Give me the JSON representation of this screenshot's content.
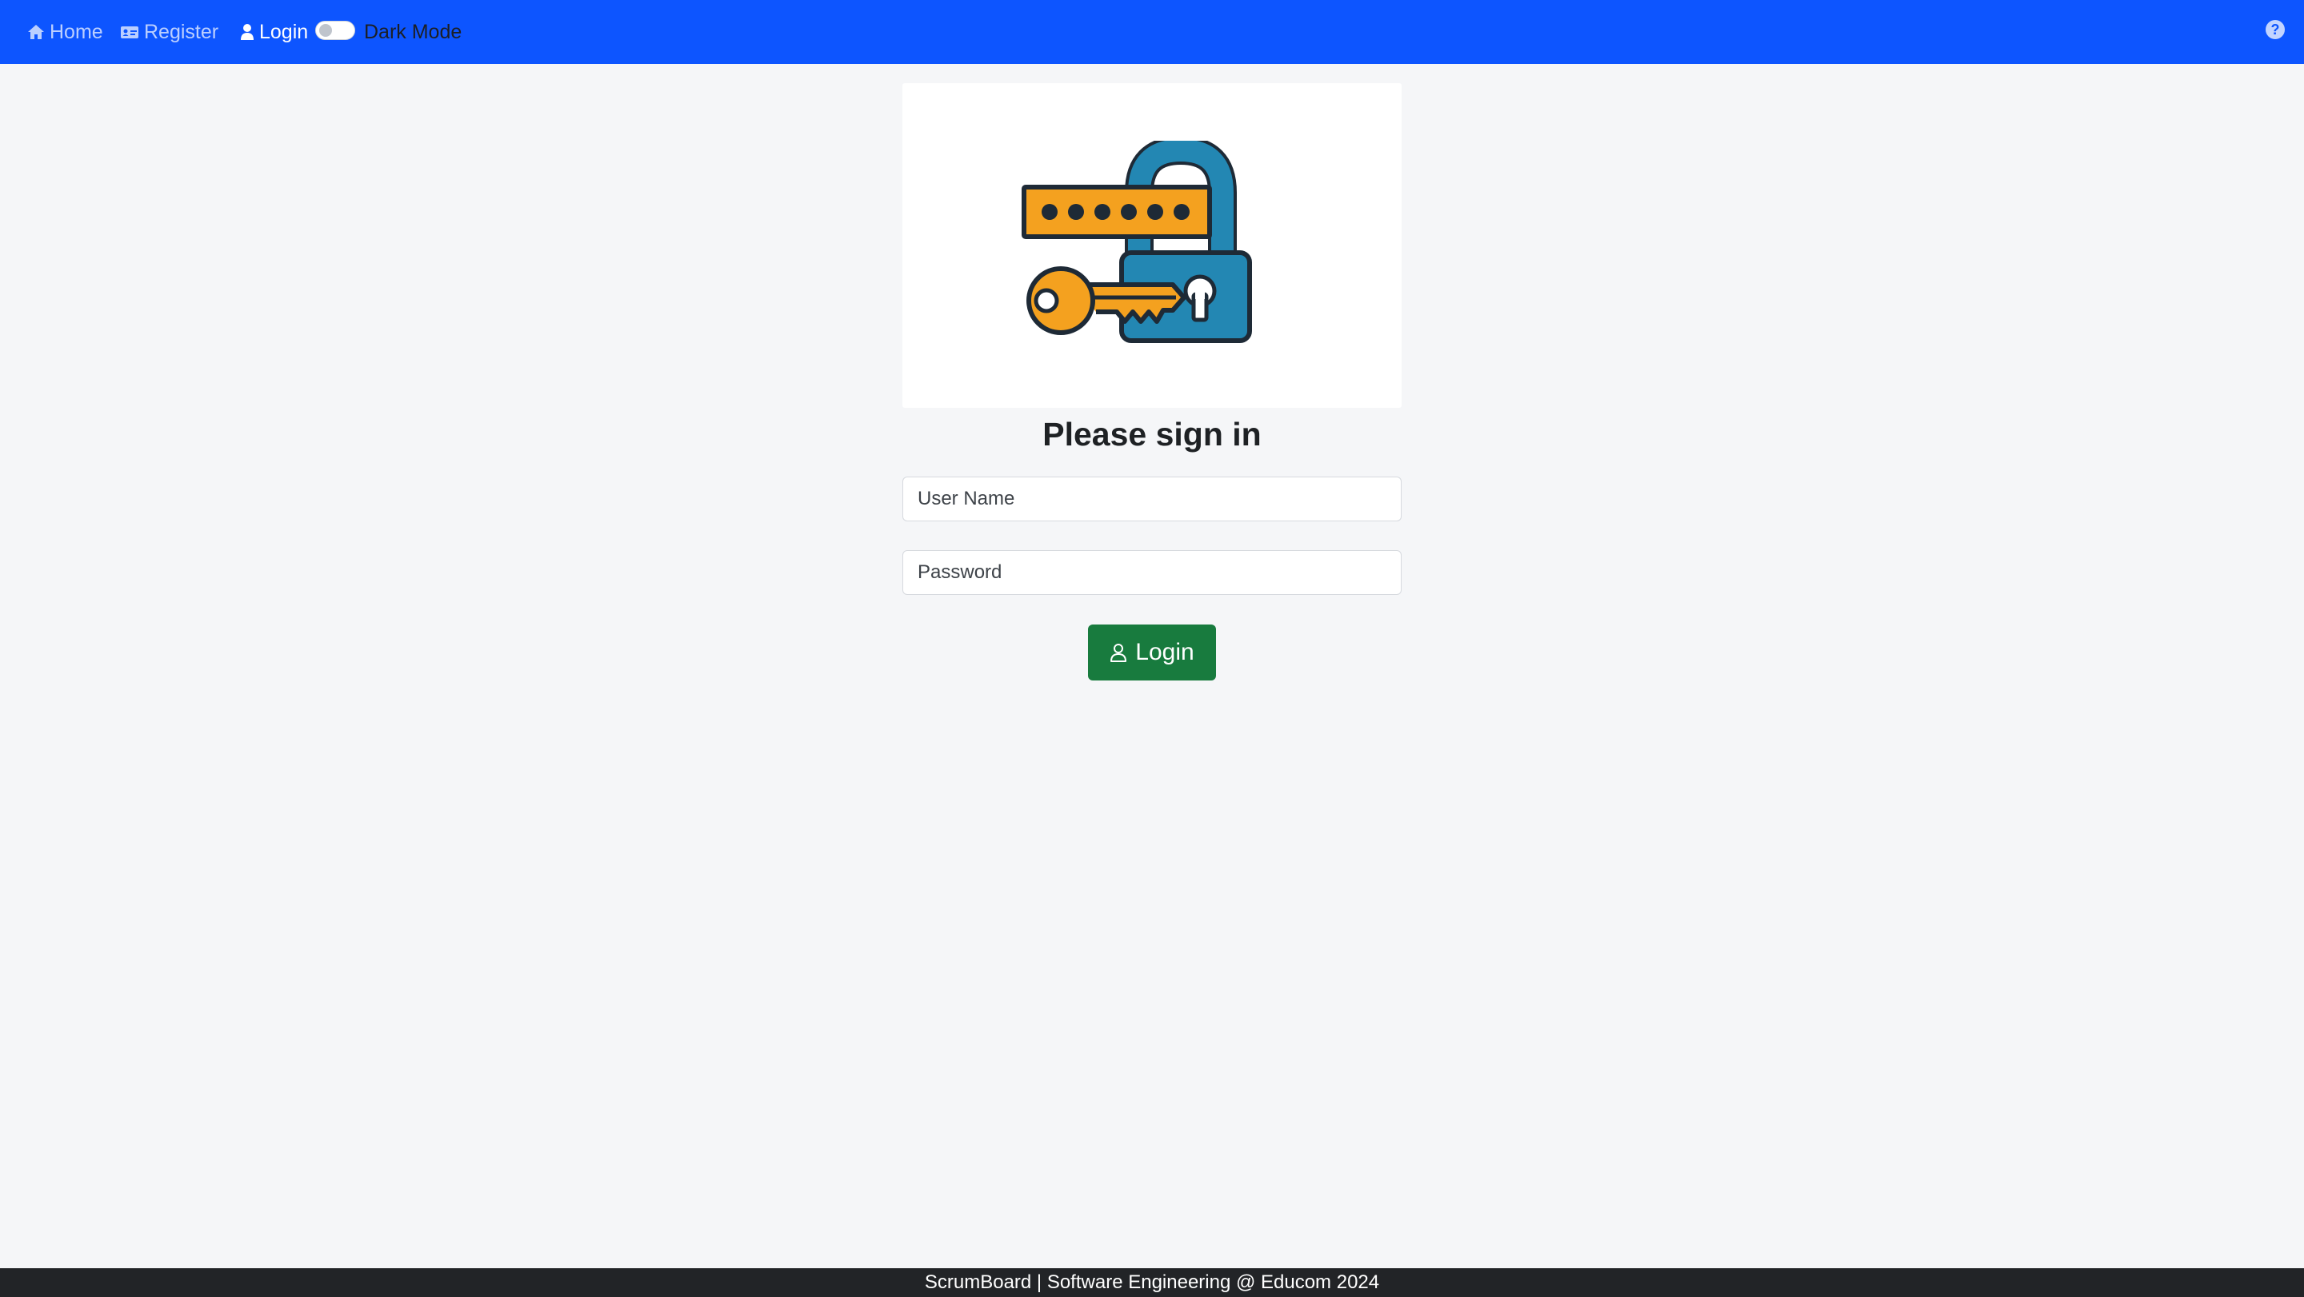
{
  "nav": {
    "home_label": "Home",
    "register_label": "Register",
    "login_label": "Login",
    "dark_mode_label": "Dark Mode",
    "dark_mode_enabled": false,
    "icons": {
      "home": "home-icon",
      "register": "id-card-icon",
      "login": "user-icon",
      "help": "question-circle-icon"
    }
  },
  "main": {
    "illustration": "password-lock-key-illustration",
    "title": "Please sign in",
    "username_placeholder": "User Name",
    "password_placeholder": "Password",
    "login_button_label": "Login",
    "login_button_icon": "person-outline-icon"
  },
  "footer": {
    "text": "ScrumBoard | Software Engineering @ Educom 2024"
  },
  "colors": {
    "navbar": "#0d55ff",
    "login_button": "#187b3e",
    "footer": "#222427",
    "page_background": "#f5f6f8"
  }
}
